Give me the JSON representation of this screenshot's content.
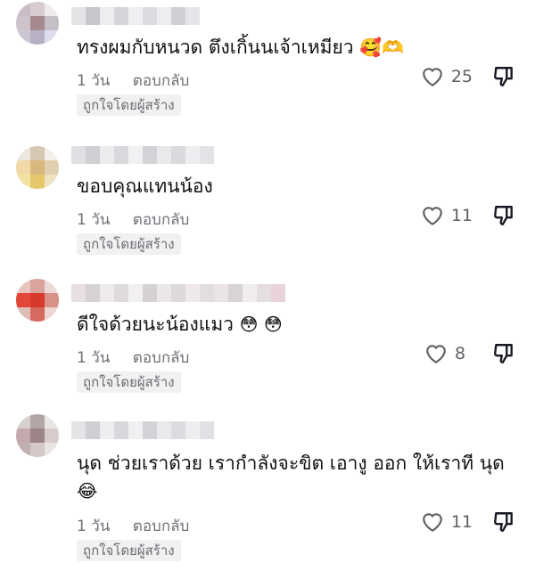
{
  "comments": [
    {
      "text": "ทรงผมกับหนวด ตึงเกิ้นนเจ้าเหมียว",
      "emojis": "🥰🫶",
      "time": "1 วัน",
      "reply_label": "ตอบกลับ",
      "badge": "ถูกใจโดยผู้สร้าง",
      "likes": "25",
      "avatar_colors": [
        "#c9bcc4",
        "#d8ccd2",
        "#f0eaee",
        "#cfc4cc",
        "#a6898f",
        "#c4bec6",
        "#cbc5d5",
        "#b8b0c4",
        "#dcdcea"
      ]
    },
    {
      "text": "ขอบคุณแทนน้อง",
      "emojis": "",
      "time": "1 วัน",
      "reply_label": "ตอบกลับ",
      "badge": "ถูกใจโดยผู้สร้าง",
      "likes": "11",
      "avatar_colors": [
        "#ece7df",
        "#d6c8b2",
        "#f3efe8",
        "#f3d8a8",
        "#d9b880",
        "#e0d0b0",
        "#f2e2a4",
        "#e6c86a",
        "#efe3c4"
      ]
    },
    {
      "text": "ดีใจด้วยนะน้องแมว",
      "emojis": "😳 😳",
      "time": "1 วัน",
      "reply_label": "ตอบกลับ",
      "badge": "ถูกใจโดยผู้สร้าง",
      "likes": "8",
      "avatar_colors": [
        "#e6c4c0",
        "#d8a49c",
        "#ecd8d4",
        "#e3473a",
        "#d63a2c",
        "#d99088",
        "#e0beb8",
        "#d66a5e",
        "#eed7d2"
      ]
    },
    {
      "text": "นุด ช่วยเราด้วย เรากำลังจะขิต เอางู ออก ให้เราที นุด",
      "emojis": "😂",
      "time": "1 วัน",
      "reply_label": "ตอบกลับ",
      "badge": "ถูกใจโดยผู้สร้าง",
      "likes": "11",
      "avatar_colors": [
        "#d6d0d0",
        "#b4a6a6",
        "#e9e6e6",
        "#c4a9ad",
        "#9c8488",
        "#d8cccc",
        "#c0b0b4",
        "#d4c8c8",
        "#eae4e4"
      ]
    }
  ],
  "usernames": [
    [
      "#e4e4e6",
      "#c8c8cc",
      "#ededf0",
      "#d6d6da",
      "#f0f0f2",
      "#dcdce0",
      "#eeeef0",
      "#d0d0d4",
      "#e6e6ea"
    ],
    [
      "#e0e0e4",
      "#cfcfd4",
      "#ececef",
      "#d9d9dd",
      "#f1f1f3",
      "#d2d2d7",
      "#e9e9ec",
      "#dadade",
      "#eeeef1",
      "#e3e3e7"
    ],
    [
      "#e7dfe2",
      "#d7d2d6",
      "#eeeaec",
      "#dedade",
      "#f2eff0",
      "#d4d0d4",
      "#ebe6e8",
      "#dcd8dc",
      "#efe9eb",
      "#e2dde0",
      "#ebe4e7",
      "#d8d3d7",
      "#f0ecef",
      "#e4dde2",
      "#e8d4d8"
    ],
    [
      "#e4e4e6",
      "#cfcfd3",
      "#ededf0",
      "#d8d8dc",
      "#f0f0f2",
      "#d3d3d7",
      "#e9e9ec",
      "#dcdce0",
      "#eeeef0",
      "#e1e1e5"
    ]
  ]
}
